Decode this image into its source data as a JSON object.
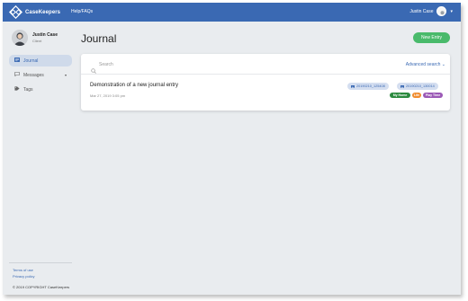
{
  "header": {
    "brand": "CaseKeepers",
    "nav_help": "Help/FAQs",
    "user_name": "Justin Case",
    "caret": "▾"
  },
  "sidebar": {
    "profile": {
      "name": "Justin Case",
      "role": "Client"
    },
    "items": [
      {
        "label": "Journal",
        "icon": "journal-icon"
      },
      {
        "label": "Messages",
        "icon": "chat-icon",
        "chevron": "▾"
      },
      {
        "label": "Tags",
        "icon": "tag-icon"
      }
    ],
    "footer": {
      "terms": "Terms of use",
      "privacy": "Privacy policy",
      "copyright": "© 2019 COPYRIGHT CaseKeepers"
    }
  },
  "main": {
    "title": "Journal",
    "new_entry_label": "New Entry",
    "search": {
      "placeholder": "Search",
      "advanced_label": "Advanced search ⌄"
    },
    "entries": [
      {
        "title": "Demonstration of a new journal entry",
        "date": "Mar 27, 2019 3:05 pm",
        "files": [
          "20190210_125408",
          "20190210_130014"
        ],
        "tags": [
          {
            "label": "My Home",
            "color": "#2b8a3e"
          },
          {
            "label": "Life",
            "color": "#f08c2e"
          },
          {
            "label": "Play Time",
            "color": "#9b59b6"
          }
        ]
      }
    ]
  },
  "colors": {
    "topbar": "#3a69b3",
    "accent": "#3a69b3",
    "new_entry": "#49ba6b",
    "background": "#e9ecef"
  }
}
